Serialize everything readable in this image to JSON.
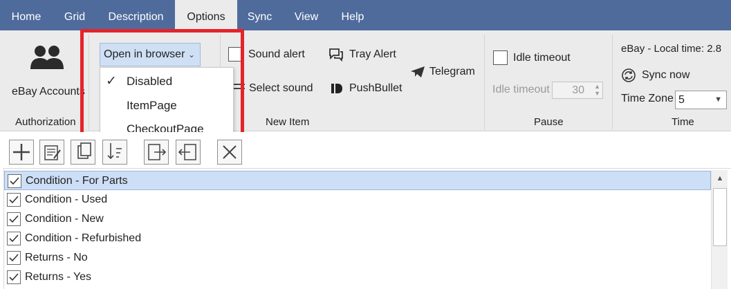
{
  "menu": {
    "tabs": [
      {
        "label": "Home"
      },
      {
        "label": "Grid"
      },
      {
        "label": "Description"
      },
      {
        "label": "Options"
      },
      {
        "label": "Sync"
      },
      {
        "label": "View"
      },
      {
        "label": "Help"
      }
    ],
    "active_tab": "Options"
  },
  "ribbon": {
    "authorization": {
      "label": "Authorization",
      "ebay_accounts": "eBay Accounts"
    },
    "new_item": {
      "label": "New Item",
      "open_in_browser": "Open in browser",
      "sound_alert": "Sound alert",
      "select_sound": "Select sound",
      "tray_alert": "Tray Alert",
      "pushbullet": "PushBullet",
      "telegram": "Telegram"
    },
    "pause": {
      "label": "Pause",
      "idle_timeout_checkbox": "Idle timeout",
      "idle_timeout_field": "Idle timeout",
      "idle_timeout_value": "30"
    },
    "time": {
      "label": "Time",
      "local_time": "eBay - Local time: 2.8",
      "sync_now": "Sync now",
      "time_zone_label": "Time Zone",
      "time_zone_value": "5"
    }
  },
  "dropdown": {
    "options": [
      {
        "label": "Disabled",
        "checked": true
      },
      {
        "label": "ItemPage",
        "checked": false
      },
      {
        "label": "CheckoutPage",
        "checked": false
      }
    ],
    "check_mark": "✓"
  },
  "list": {
    "rows": [
      {
        "label": "Condition - For Parts",
        "checked": true,
        "selected": true
      },
      {
        "label": "Condition - Used",
        "checked": true,
        "selected": false
      },
      {
        "label": "Condition - New",
        "checked": true,
        "selected": false
      },
      {
        "label": "Condition - Refurbished",
        "checked": true,
        "selected": false
      },
      {
        "label": "Returns - No",
        "checked": true,
        "selected": false
      },
      {
        "label": "Returns - Yes",
        "checked": true,
        "selected": false
      }
    ]
  },
  "colors": {
    "menubar": "#4f6b9c",
    "ribbon": "#ebebeb",
    "highlight": "#e5232a",
    "selected_row": "#cddff7"
  }
}
